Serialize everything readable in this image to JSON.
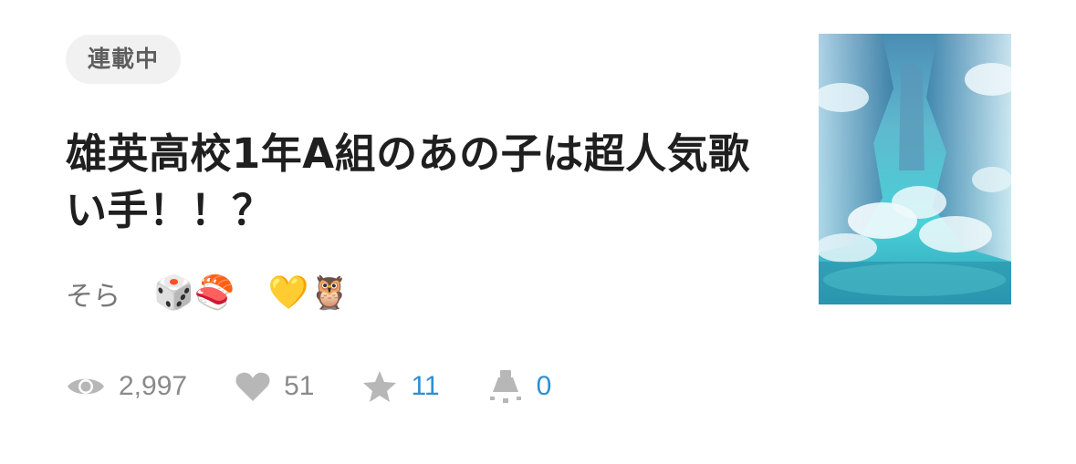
{
  "status_badge": "連載中",
  "title": "雄英高校1年A組のあの子は超人気歌い手！！？",
  "author": {
    "name": "そら",
    "emoji": "🎲🍣　💛🦉"
  },
  "stats": {
    "views": "2,997",
    "likes": "51",
    "stars": "11",
    "reactions": "0"
  },
  "icons": {
    "views": "eye-icon",
    "likes": "heart-icon",
    "stars": "star-icon",
    "reactions": "spotlight-icon"
  },
  "colors": {
    "badge_bg": "#f1f1f1",
    "title_text": "#1f1f1f",
    "muted_text": "#8a8a8a",
    "link_blue": "#2f8fd0"
  }
}
